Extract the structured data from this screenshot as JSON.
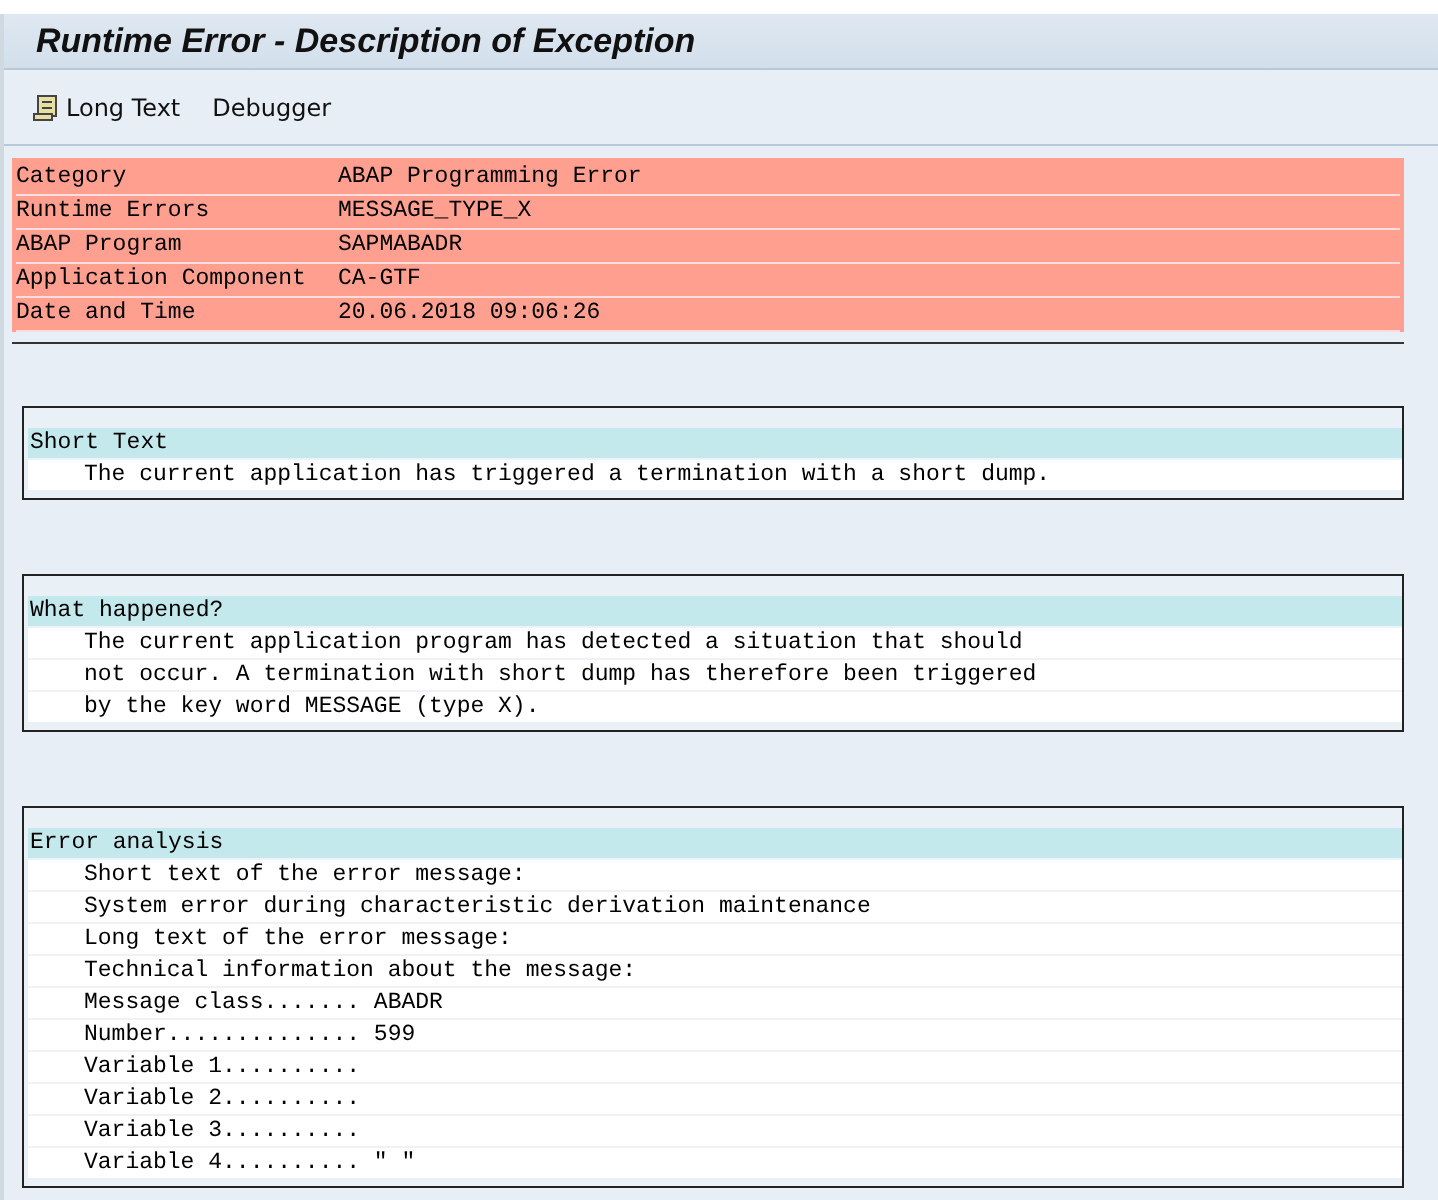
{
  "window": {
    "title": "Runtime Error - Description of Exception"
  },
  "toolbar": {
    "buttons": [
      {
        "label": "Long Text",
        "kind": "icon"
      },
      {
        "label": "Debugger",
        "kind": "plain"
      }
    ]
  },
  "header": {
    "rows": [
      {
        "label": "Category",
        "value": "ABAP Programming Error"
      },
      {
        "label": "Runtime Errors",
        "value": "MESSAGE_TYPE_X"
      },
      {
        "label": "ABAP Program",
        "value": "SAPMABADR"
      },
      {
        "label": "Application Component",
        "value": "CA-GTF"
      },
      {
        "label": "Date and Time",
        "value": "20.06.2018 09:06:26"
      }
    ]
  },
  "sections": [
    {
      "title": "Short Text",
      "lines": [
        "The current application has triggered a termination with a short dump."
      ]
    },
    {
      "title": "What happened?",
      "lines": [
        "The current application program has detected a situation that should",
        "not occur. A termination with short dump has therefore been triggered",
        "by the key word MESSAGE (type X)."
      ]
    },
    {
      "title": "Error analysis",
      "lines": [
        "Short text of the error message:",
        "System error during characteristic derivation maintenance",
        "Long text of the error message:",
        "Technical information about the message:",
        "Message class....... ABADR",
        "Number.............. 599",
        "Variable 1..........",
        "Variable 2..........",
        "Variable 3..........",
        "Variable 4.......... \" \""
      ]
    }
  ]
}
